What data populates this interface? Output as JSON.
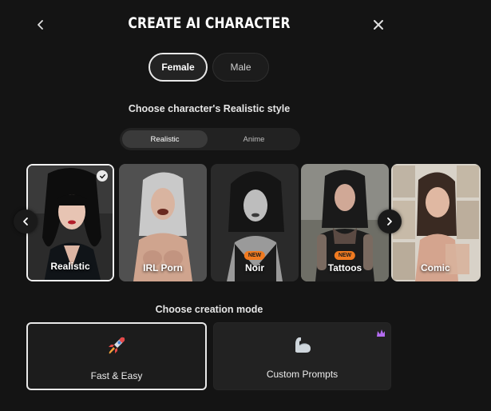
{
  "header": {
    "title": "CREATE AI CHARACTER"
  },
  "gender": {
    "female_label": "Female",
    "male_label": "Male",
    "selected": "Female"
  },
  "style_section": {
    "heading": "Choose character's Realistic style",
    "toggle": [
      "Realistic",
      "Anime"
    ],
    "selected": "Realistic"
  },
  "style_cards": [
    {
      "label": "Realistic",
      "badge": "",
      "selected": true
    },
    {
      "label": "IRL Porn",
      "badge": ""
    },
    {
      "label": "Noir",
      "badge": "NEW"
    },
    {
      "label": "Tattoos",
      "badge": "NEW"
    },
    {
      "label": "Comic",
      "badge": ""
    }
  ],
  "mode_section": {
    "heading": "Choose creation mode",
    "options": [
      {
        "label": "Fast & Easy",
        "icon": "rocket-icon",
        "selected": true
      },
      {
        "label": "Custom Prompts",
        "icon": "flexed-arm-icon",
        "premium_icon": "purple-crown-icon"
      }
    ]
  },
  "colors": {
    "background": "#141414",
    "badge_new": "#f07a20",
    "selected_border": "#e9e9e9",
    "premium": "#b46cf0"
  }
}
